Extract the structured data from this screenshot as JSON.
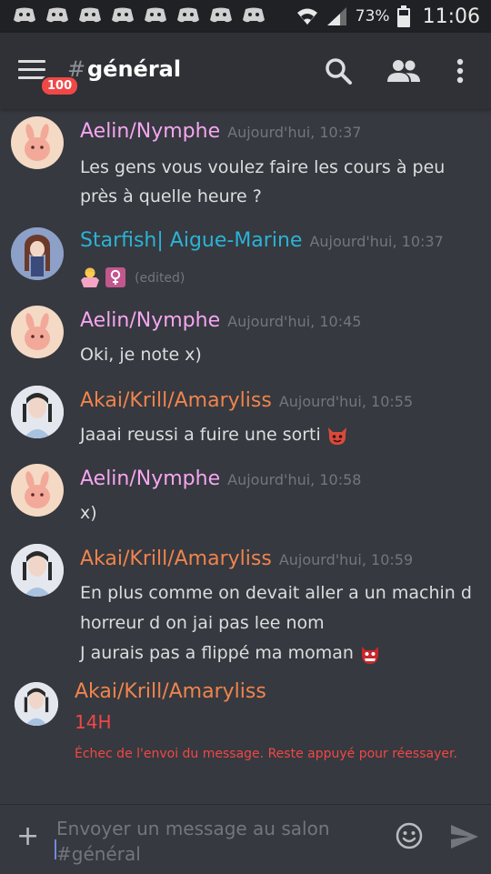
{
  "status_bar": {
    "battery": "73%",
    "time": "11:06"
  },
  "header": {
    "hash": "#",
    "channel": "général",
    "badge": "100"
  },
  "messages": [
    {
      "author": "Aelin/Nymphe",
      "time": "Aujourd'hui, 10:37",
      "lines": [
        "Les gens vous voulez faire les cours à peu",
        "près à quelle heure ?"
      ]
    },
    {
      "author": "Starfish| Aigue-Marine",
      "time": "Aujourd'hui, 10:37",
      "edited": "(edited)",
      "emoji": [
        "person-shrugging",
        "female-sign"
      ]
    },
    {
      "author": "Aelin/Nymphe",
      "time": "Aujourd'hui, 10:45",
      "lines": [
        "Oki, je note x)"
      ]
    },
    {
      "author": "Akai/Krill/Amaryliss",
      "time": "Aujourd'hui, 10:55",
      "lines": [
        "Jaaai reussi  a fuire une sorti"
      ],
      "emoji": "devil-face"
    },
    {
      "author": "Aelin/Nymphe",
      "time": "Aujourd'hui, 10:58",
      "lines": [
        "x)"
      ]
    },
    {
      "author": "Akai/Krill/Amaryliss",
      "time": "Aujourd'hui, 10:59",
      "lines": [
        "En plus comme on devait aller a un machin d",
        "horreur d on jai pas lee nom",
        "J aurais pas a flippé ma moman"
      ],
      "emoji": "ogre-face"
    },
    {
      "author": "Akai/Krill/Amaryliss",
      "lines": [
        "14H"
      ],
      "error": "Échec de l'envoi du message. Reste appuyé pour réessayer."
    }
  ],
  "composer": {
    "placeholder": "Envoyer un message au salon #général"
  },
  "colors": {
    "pink": "#f5a6f0",
    "teal": "#2bb3d6",
    "orange": "#f0844d",
    "error": "#f04747"
  }
}
